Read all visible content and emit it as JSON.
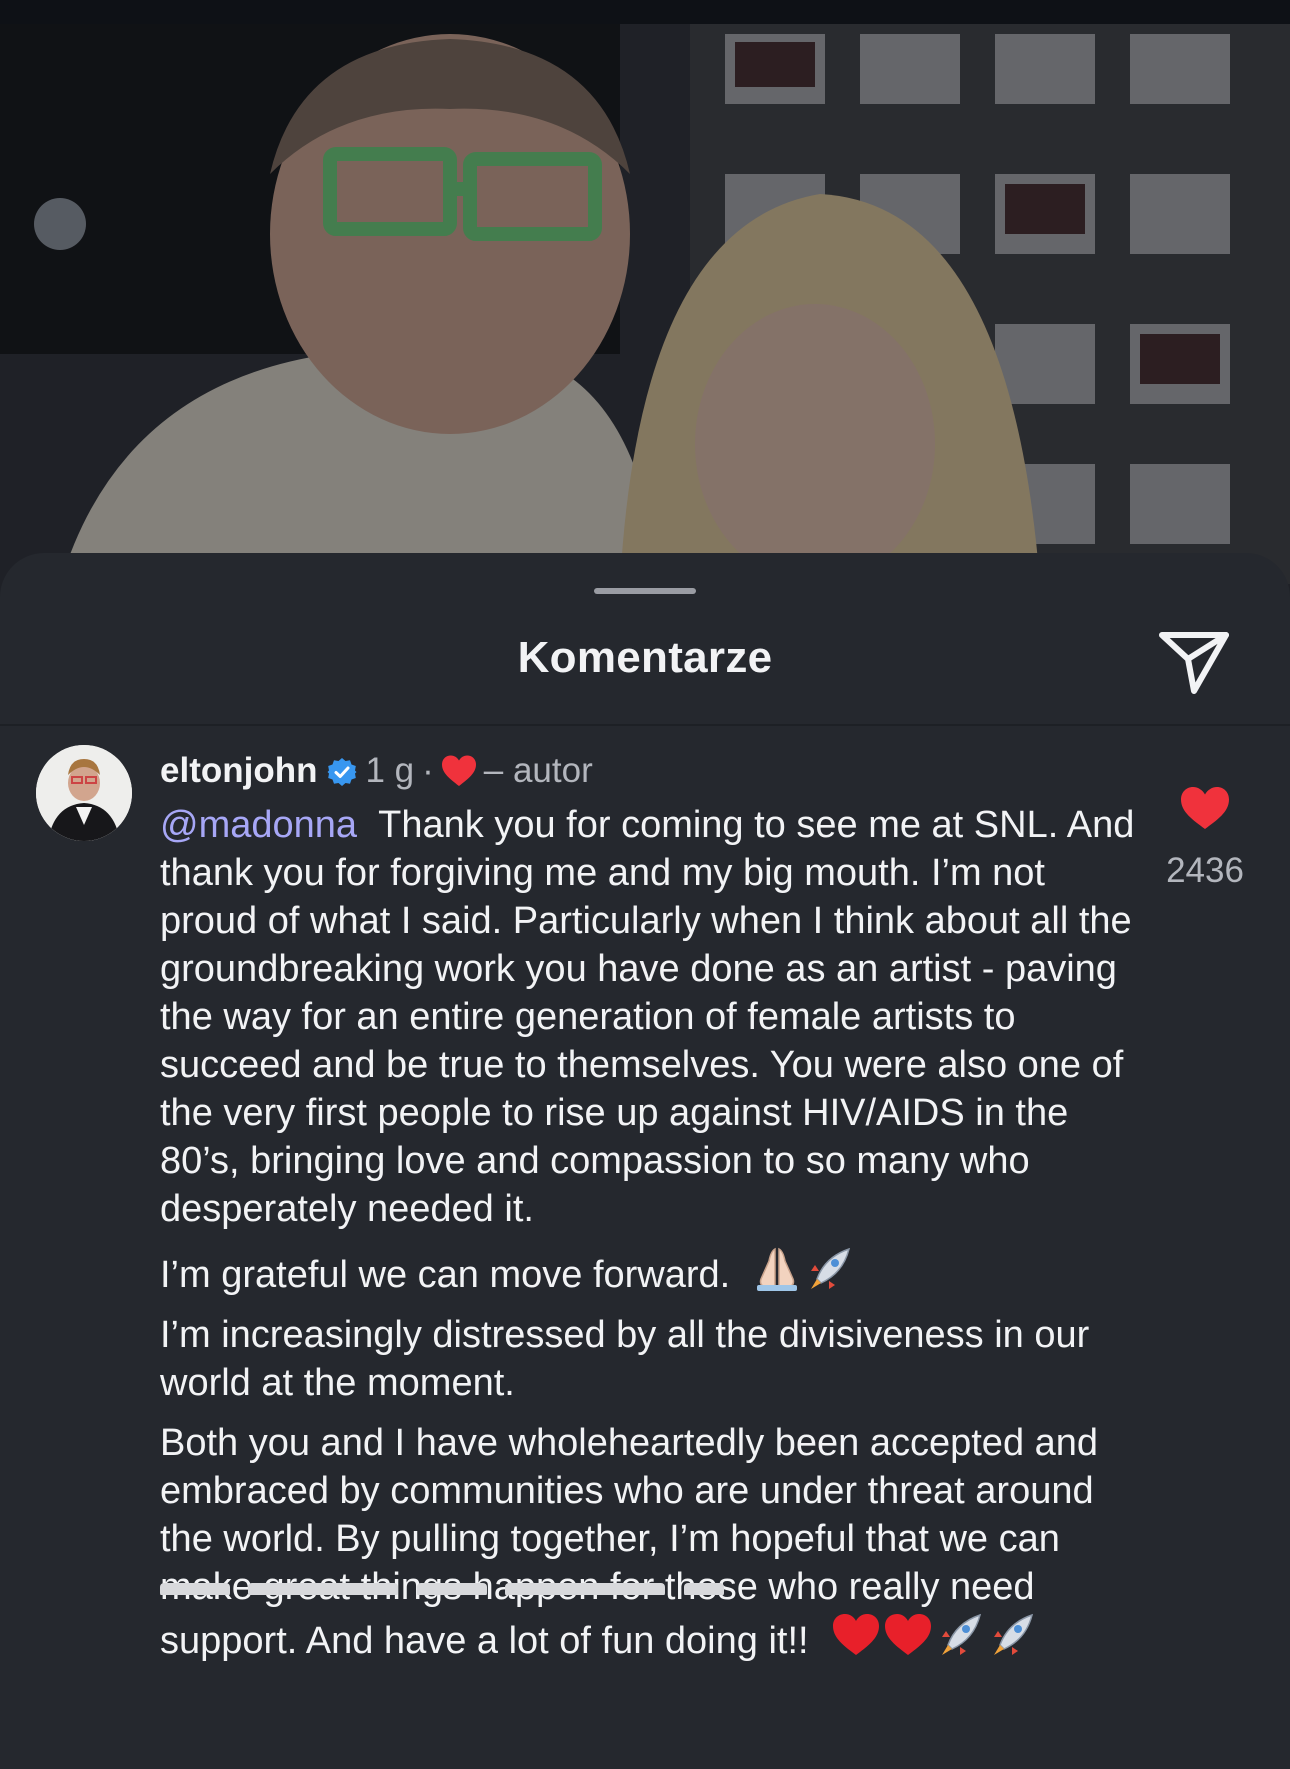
{
  "sheet": {
    "title": "Komentarze",
    "share_icon": "paper-plane-icon"
  },
  "comment": {
    "username": "eltonjohn",
    "verified_icon": "verified-badge-icon",
    "time": "1 g",
    "separator": "·",
    "author_label": "– autor",
    "author_heart_icon": "heart-icon",
    "mention": "@madonna",
    "paragraphs": [
      "Thank you for coming to see me at SNL.  And thank you for  forgiving me and my big mouth.  I’m not proud of what I said.  Particularly when I think about all the groundbreaking work you have done as an artist - paving the way for an entire generation of female artists to succeed and be true to themselves.  You were also one of the very first people to rise up against HIV/AIDS in the 80’s, bringing love and compassion to so many who desperately needed it.",
      "I’m grateful we can move forward.",
      "I’m increasingly distressed by all the divisiveness in our world at the moment.",
      "Both you and I have wholeheartedly been accepted and embraced by communities who are under threat around the world.  By pulling together, I’m hopeful that we can make great things happen for those who really need support. And have a lot of fun doing it!!"
    ],
    "emoji_after_p2": [
      "folded-hands-emoji",
      "rocket-emoji"
    ],
    "emoji_after_p4": [
      "red-heart-emoji",
      "red-heart-emoji",
      "rocket-emoji",
      "rocket-emoji"
    ],
    "like_count": "2436"
  },
  "colors": {
    "sheet_bg": "#25282e",
    "mention": "#a7a7f6",
    "like_red": "#f0323c",
    "verified_blue": "#3897f0"
  }
}
